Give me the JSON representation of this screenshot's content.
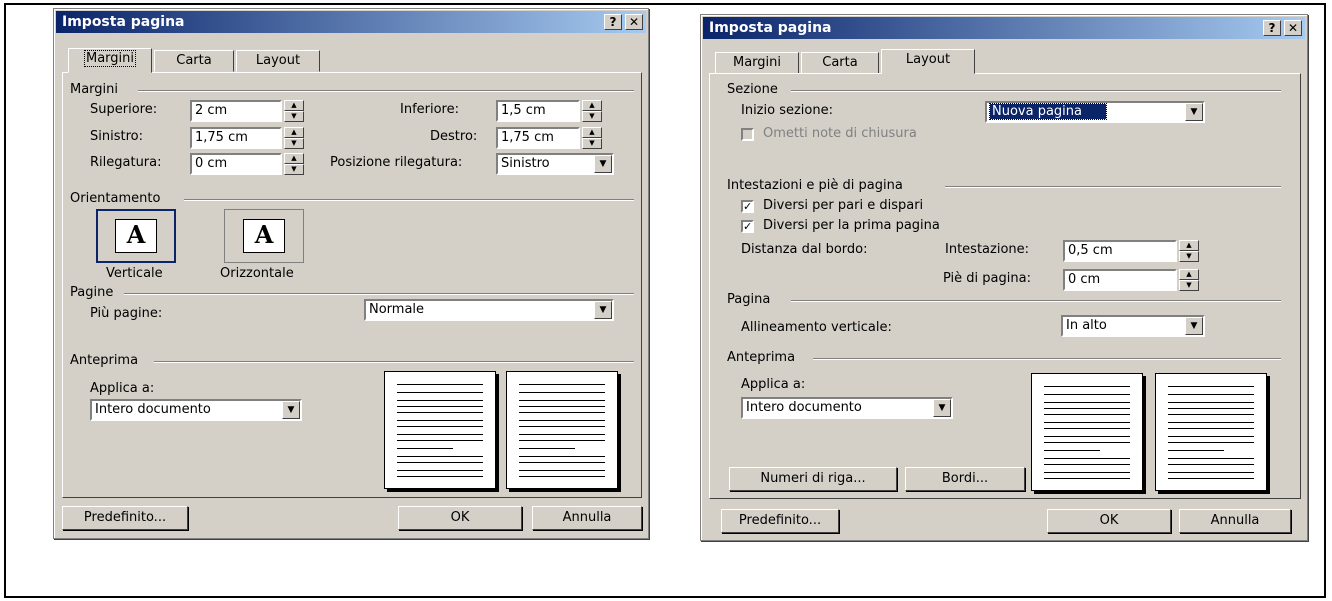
{
  "left": {
    "title": "Imposta pagina",
    "help": "?",
    "close": "✕",
    "tabs": [
      "Margini",
      "Carta",
      "Layout"
    ],
    "margini_group": "Margini",
    "superiore_label": "Superiore:",
    "superiore_value": "2 cm",
    "inferiore_label": "Inferiore:",
    "inferiore_value": "1,5 cm",
    "sinistro_label": "Sinistro:",
    "sinistro_value": "1,75 cm",
    "destro_label": "Destro:",
    "destro_value": "1,75 cm",
    "rilegatura_label": "Rilegatura:",
    "rilegatura_value": "0 cm",
    "posizione_label": "Posizione rilegatura:",
    "posizione_value": "Sinistro",
    "orientamento_group": "Orientamento",
    "verticale_label": "Verticale",
    "orizzontale_label": "Orizzontale",
    "icon_letter": "A",
    "pagine_group": "Pagine",
    "piu_pagine_label": "Più pagine:",
    "piu_pagine_value": "Normale",
    "anteprima_group": "Anteprima",
    "applica_label": "Applica a:",
    "applica_value": "Intero documento",
    "predefinito": "Predefinito...",
    "ok": "OK",
    "annulla": "Annulla"
  },
  "right": {
    "title": "Imposta pagina",
    "help": "?",
    "close": "✕",
    "tabs": [
      "Margini",
      "Carta",
      "Layout"
    ],
    "sezione_group": "Sezione",
    "inizio_label": "Inizio sezione:",
    "inizio_value": "Nuova pagina",
    "ometti_label": "Ometti note di chiusura",
    "intestazioni_group": "Intestazioni e piè di pagina",
    "diversi_pari_label": "Diversi per pari e dispari",
    "diversi_prima_label": "Diversi per la prima pagina",
    "check_mark": "✓",
    "distanza_label": "Distanza dal bordo:",
    "intestazione_label": "Intestazione:",
    "intestazione_value": "0,5 cm",
    "pie_label": "Piè di pagina:",
    "pie_value": "0 cm",
    "pagina_group": "Pagina",
    "allineamento_label": "Allineamento verticale:",
    "allineamento_value": "In alto",
    "anteprima_group": "Anteprima",
    "applica_label": "Applica a:",
    "applica_value": "Intero documento",
    "numeri_riga": "Numeri di riga...",
    "bordi": "Bordi...",
    "predefinito": "Predefinito...",
    "ok": "OK",
    "annulla": "Annulla"
  }
}
